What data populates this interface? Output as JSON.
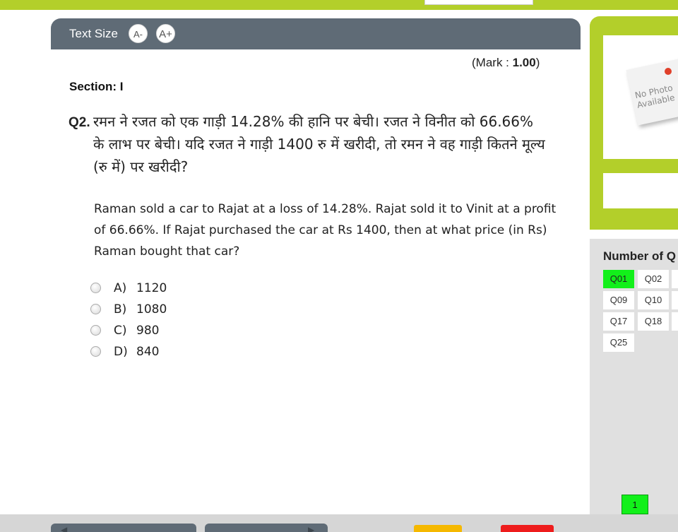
{
  "toolbar": {
    "text_size_label": "Text Size",
    "decrease_label": "A-",
    "increase_label": "A+"
  },
  "question": {
    "mark_prefix": "(Mark : ",
    "mark_value": "1.00",
    "mark_suffix": ")",
    "section": "Section: I",
    "number": "Q2.",
    "text_hindi": "रमन ने रजत को एक गाड़ी 14.28% की हानि पर बेची। रजत ने विनीत को 66.66% के लाभ पर बेची। यदि रजत ने गाड़ी 1400 रु में खरीदी, तो रमन ने वह गाड़ी कितने मूल्य (रु में) पर खरीदी?",
    "text_english": "Raman sold a car to Rajat at a loss of 14.28%. Rajat sold it to Vinit at a profit of 66.66%. If Rajat purchased the car at Rs 1400, then at what price (in Rs) Raman bought that car?",
    "options": [
      {
        "label": "A)",
        "value": "1120"
      },
      {
        "label": "B)",
        "value": "1080"
      },
      {
        "label": "C)",
        "value": "980"
      },
      {
        "label": "D)",
        "value": "840"
      }
    ]
  },
  "profile": {
    "photo_text": "No Photo Available"
  },
  "palette": {
    "title": "Number of Q",
    "questions": [
      "Q01",
      "Q02",
      "Q09",
      "Q10",
      "Q17",
      "Q18",
      "Q25"
    ],
    "answered": [
      "Q01"
    ],
    "legend_count": "1"
  },
  "colors": {
    "brand_green": "#b3cf2a",
    "header_slate": "#5f6b76",
    "answered_green": "#12f01a",
    "panel_grey": "#e0e0e0",
    "yellow_button": "#f5b800",
    "red_button": "#ee1c1c"
  }
}
